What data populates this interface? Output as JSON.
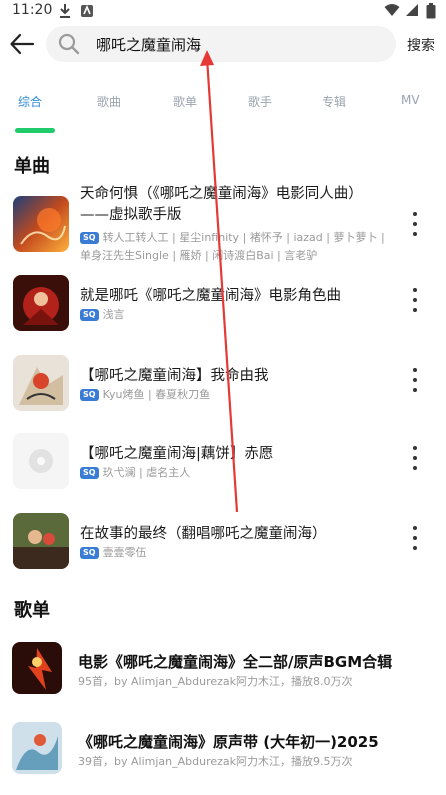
{
  "status_bar": {
    "time": "11:20"
  },
  "search": {
    "query": "哪吒之魔童闹海",
    "button_label": "搜索"
  },
  "tabs": [
    {
      "label": "综合",
      "active": true
    },
    {
      "label": "歌曲",
      "active": false
    },
    {
      "label": "歌单",
      "active": false
    },
    {
      "label": "歌手",
      "active": false
    },
    {
      "label": "专辑",
      "active": false
    },
    {
      "label": "MV",
      "active": false
    }
  ],
  "songs_section": {
    "title": "单曲",
    "items": [
      {
        "title": "天命何惧（《哪吒之魔童闹海》电影同人曲）——虚拟歌手版",
        "badge": "SQ",
        "artists": "转人工转人工 | 星尘infinity | 褚怀予 | iazad | 萝卜萝卜 | 单身汪先生Single | 雁娇 | 闲诗渡白Bai | 言老驴"
      },
      {
        "title": "就是哪吒《哪吒之魔童闹海》电影角色曲",
        "badge": "SQ",
        "artists": "浅言"
      },
      {
        "title": "【哪吒之魔童闹海】我命由我",
        "badge": "SQ",
        "artists": "Kyu烤鱼 | 春夏秋刀鱼"
      },
      {
        "title": "【哪吒之魔童闹海|藕饼】赤愿",
        "badge": "SQ",
        "artists": "玖弋澜 | 虐名主人"
      },
      {
        "title": "在故事的最终（翻唱哪吒之魔童闹海）",
        "badge": "SQ",
        "artists": "壹壹零伍"
      }
    ]
  },
  "playlists_section": {
    "title": "歌单",
    "items": [
      {
        "title": "电影《哪吒之魔童闹海》全二部/原声BGM合辑",
        "meta": "95首，by Alimjan_Abdurezak阿力木江，播放8.0万次"
      },
      {
        "title": "《哪吒之魔童闹海》原声带 (大年初一)2025",
        "meta": "39首，by Alimjan_Abdurezak阿力木江，播放9.5万次"
      }
    ]
  },
  "colors": {
    "accent_tab": "#2e8bd8",
    "indicator": "#1fcb6a",
    "annotation_arrow": "#e53935",
    "sq_badge": "#3a7bd5"
  },
  "icons": [
    "back-arrow-icon",
    "search-icon",
    "more-vert-icon",
    "download-icon",
    "wifi-icon",
    "signal-icon",
    "battery-icon"
  ]
}
